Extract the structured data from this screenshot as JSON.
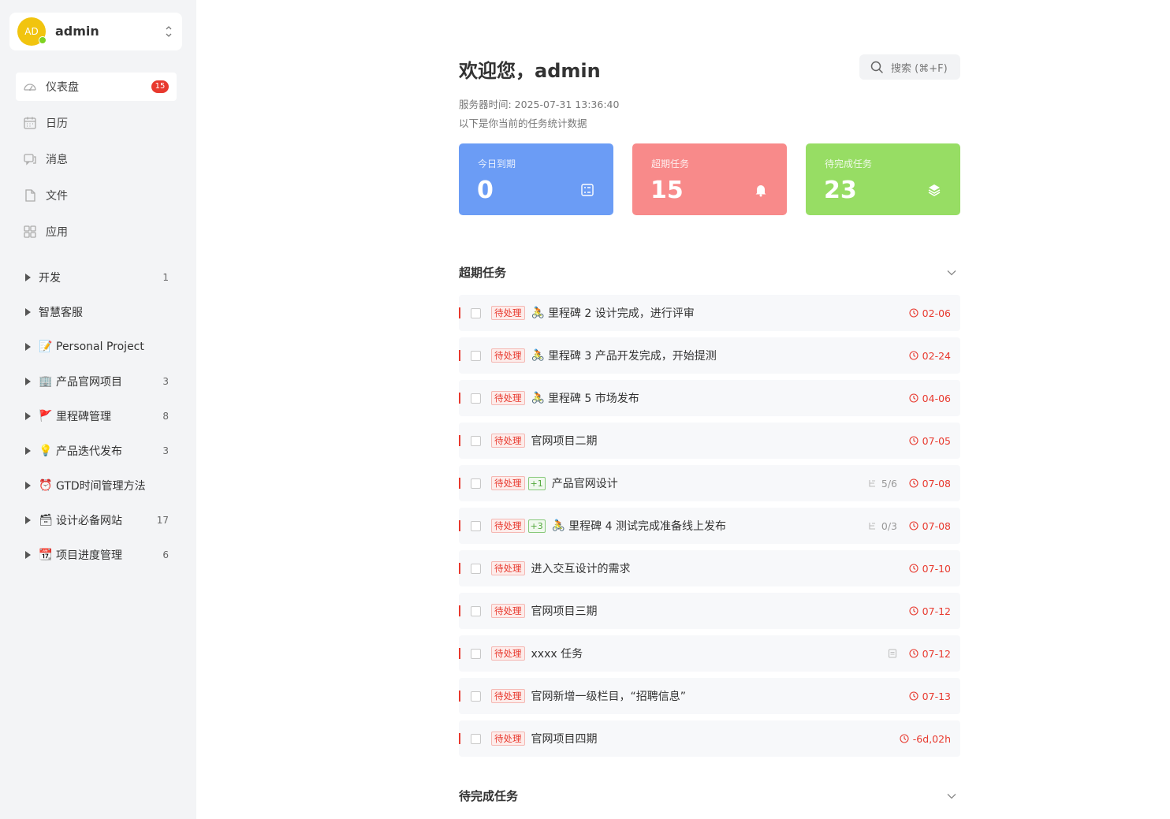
{
  "user": {
    "avatar_text": "AD",
    "name": "admin"
  },
  "nav": [
    {
      "label": "仪表盘",
      "icon": "dashboard-icon",
      "badge": "15",
      "active": true
    },
    {
      "label": "日历",
      "icon": "calendar-icon"
    },
    {
      "label": "消息",
      "icon": "message-icon"
    },
    {
      "label": "文件",
      "icon": "file-icon"
    },
    {
      "label": "应用",
      "icon": "apps-icon"
    }
  ],
  "projects": [
    {
      "emoji": "",
      "name": "开发",
      "count": "1"
    },
    {
      "emoji": "",
      "name": "智慧客服",
      "count": ""
    },
    {
      "emoji": "📝",
      "name": "Personal Project",
      "count": ""
    },
    {
      "emoji": "🏢",
      "name": "产品官网项目",
      "count": "3"
    },
    {
      "emoji": "🚩",
      "name": "里程碑管理",
      "count": "8"
    },
    {
      "emoji": "💡",
      "name": "产品迭代发布",
      "count": "3"
    },
    {
      "emoji": "⏰",
      "name": "GTD时间管理方法",
      "count": ""
    },
    {
      "emoji": "🗃",
      "name": "设计必备网站",
      "count": "17"
    },
    {
      "emoji": "📆",
      "name": "项目进度管理",
      "count": "6"
    }
  ],
  "main": {
    "welcome": "欢迎您，admin",
    "search_placeholder": "搜索 (⌘+F)",
    "server_time": "服务器时间: 2025-07-31 13:36:40",
    "subtitle": "以下是你当前的任务统计数据"
  },
  "stats": [
    {
      "label": "今日到期",
      "value": "0",
      "color": "#6b9cf5",
      "icon": "checklist-icon"
    },
    {
      "label": "超期任务",
      "value": "15",
      "color": "#f88a8a",
      "icon": "bell-icon"
    },
    {
      "label": "待完成任务",
      "value": "23",
      "color": "#97dd64",
      "icon": "layers-icon"
    }
  ],
  "sections": {
    "overdue_title": "超期任务",
    "pending_title": "待完成任务"
  },
  "tasks": [
    {
      "tag": "待处理",
      "plus": "",
      "emoji": "🚴",
      "title": "里程碑 2 设计完成，进行评审",
      "sub": "",
      "doc": false,
      "due": "02-06"
    },
    {
      "tag": "待处理",
      "plus": "",
      "emoji": "🚴",
      "title": "里程碑 3 产品开发完成，开始提测",
      "sub": "",
      "doc": false,
      "due": "02-24"
    },
    {
      "tag": "待处理",
      "plus": "",
      "emoji": "🚴",
      "title": "里程碑 5 市场发布",
      "sub": "",
      "doc": false,
      "due": "04-06"
    },
    {
      "tag": "待处理",
      "plus": "",
      "emoji": "",
      "title": "官网项目二期",
      "sub": "",
      "doc": false,
      "due": "07-05"
    },
    {
      "tag": "待处理",
      "plus": "+1",
      "emoji": "",
      "title": "产品官网设计",
      "sub": "5/6",
      "doc": false,
      "due": "07-08"
    },
    {
      "tag": "待处理",
      "plus": "+3",
      "emoji": "🚴",
      "title": "里程碑 4 测试完成准备线上发布",
      "sub": "0/3",
      "doc": false,
      "due": "07-08"
    },
    {
      "tag": "待处理",
      "plus": "",
      "emoji": "",
      "title": "进入交互设计的需求",
      "sub": "",
      "doc": false,
      "due": "07-10"
    },
    {
      "tag": "待处理",
      "plus": "",
      "emoji": "",
      "title": "官网项目三期",
      "sub": "",
      "doc": false,
      "due": "07-12"
    },
    {
      "tag": "待处理",
      "plus": "",
      "emoji": "",
      "title": "xxxx 任务",
      "sub": "",
      "doc": true,
      "due": "07-12"
    },
    {
      "tag": "待处理",
      "plus": "",
      "emoji": "",
      "title": "官网新增一级栏目，“招聘信息”",
      "sub": "",
      "doc": false,
      "due": "07-13"
    },
    {
      "tag": "待处理",
      "plus": "",
      "emoji": "",
      "title": "官网项目四期",
      "sub": "",
      "doc": false,
      "due": "-6d,02h"
    }
  ]
}
